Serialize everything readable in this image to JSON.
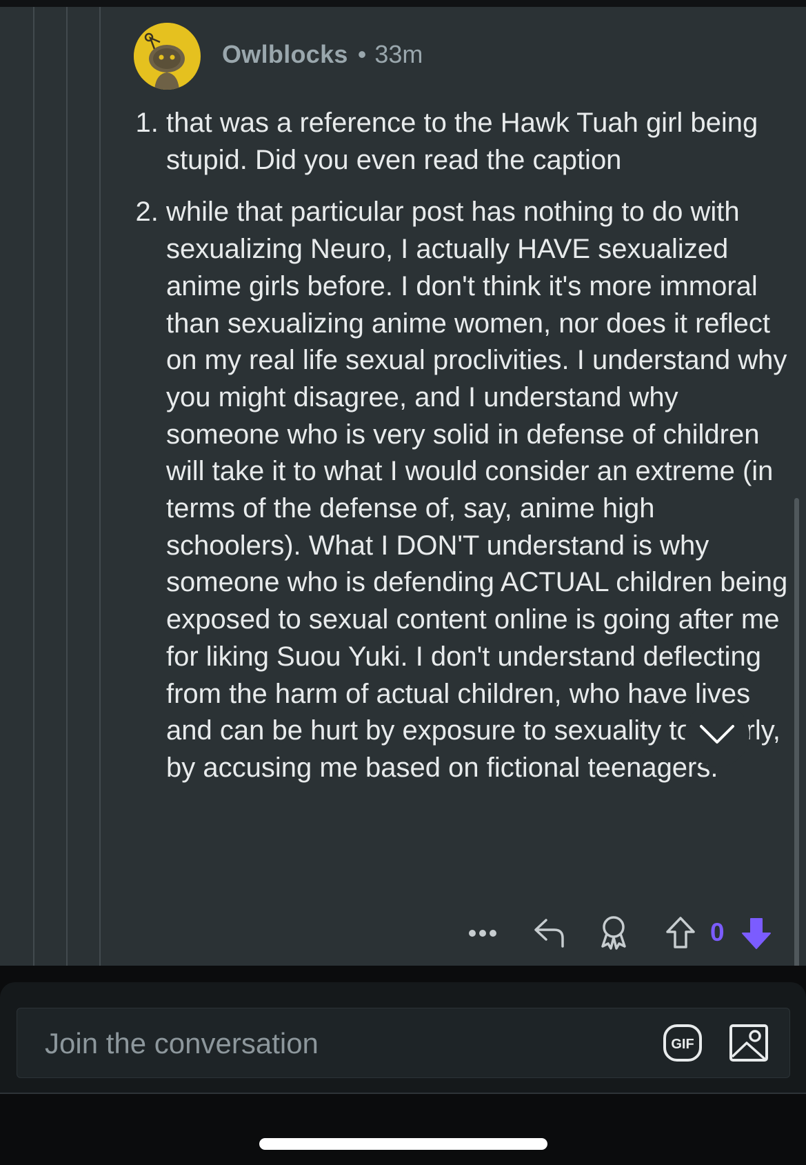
{
  "comment": {
    "author": "Owlblocks",
    "separator": "•",
    "age": "33m",
    "points": [
      "that was a reference to the Hawk Tuah girl being stupid. Did you even read the caption",
      "while that particular post has nothing to do with sexualizing Neuro, I actually HAVE sexualized anime girls before. I don't think it's more immoral than sexualizing anime women, nor does it reflect on my real life sexual proclivities. I understand why you might disagree, and I understand why someone who is very solid in defense of children will take it to what I would consider an extreme (in terms of the defense of, say, anime high schoolers). What I DON'T understand is why someone who is defending ACTUAL children being exposed to sexual content online is going after me for liking Suou Yuki. I don't understand deflecting from the harm of actual children, who have lives and can be hurt by exposure to sexuality too early, by accusing me based on fictional teenagers."
    ],
    "vote_count": "0"
  },
  "composer": {
    "placeholder": "Join the conversation",
    "gif_label": "GIF"
  },
  "colors": {
    "background": "#2b3235",
    "accent_vote": "#7b5cff",
    "avatar": "#e5c11f",
    "text": "#e8ebec",
    "author": "#9aa7ad"
  },
  "icons": {
    "more": "more-options-icon",
    "reply": "reply-icon",
    "award": "award-icon",
    "upvote": "upvote-icon",
    "downvote": "downvote-icon",
    "collapse": "chevron-down-icon",
    "gif": "gif-icon",
    "image": "image-icon"
  }
}
